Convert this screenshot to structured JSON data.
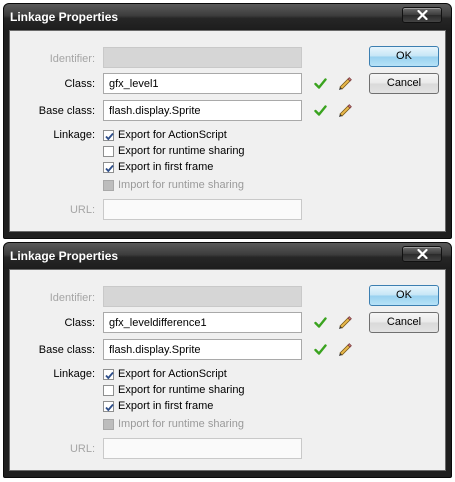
{
  "dialogs": [
    {
      "title": "Linkage Properties",
      "labels": {
        "identifier": "Identifier:",
        "class": "Class:",
        "base_class": "Base class:",
        "linkage": "Linkage:",
        "url": "URL:"
      },
      "identifier_value": "",
      "class_value": "gfx_level1",
      "base_class_value": "flash.display.Sprite",
      "url_value": "",
      "linkage_options": [
        {
          "label": "Export for ActionScript",
          "checked": true,
          "enabled": true
        },
        {
          "label": "Export for runtime sharing",
          "checked": false,
          "enabled": true
        },
        {
          "label": "Export in first frame",
          "checked": true,
          "enabled": true
        },
        {
          "label": "Import for runtime sharing",
          "checked": false,
          "enabled": false
        }
      ],
      "buttons": {
        "ok": "OK",
        "cancel": "Cancel"
      }
    },
    {
      "title": "Linkage Properties",
      "labels": {
        "identifier": "Identifier:",
        "class": "Class:",
        "base_class": "Base class:",
        "linkage": "Linkage:",
        "url": "URL:"
      },
      "identifier_value": "",
      "class_value": "gfx_leveldifference1",
      "base_class_value": "flash.display.Sprite",
      "url_value": "",
      "linkage_options": [
        {
          "label": "Export for ActionScript",
          "checked": true,
          "enabled": true
        },
        {
          "label": "Export for runtime sharing",
          "checked": false,
          "enabled": true
        },
        {
          "label": "Export in first frame",
          "checked": true,
          "enabled": true
        },
        {
          "label": "Import for runtime sharing",
          "checked": false,
          "enabled": false
        }
      ],
      "buttons": {
        "ok": "OK",
        "cancel": "Cancel"
      }
    }
  ],
  "colors": {
    "check_valid": "#3aa31f",
    "default_button_border": "#3c7fb1",
    "titlebar": "#262626"
  },
  "icons": {
    "close": "close-icon",
    "valid": "check-icon",
    "edit": "pencil-icon"
  }
}
